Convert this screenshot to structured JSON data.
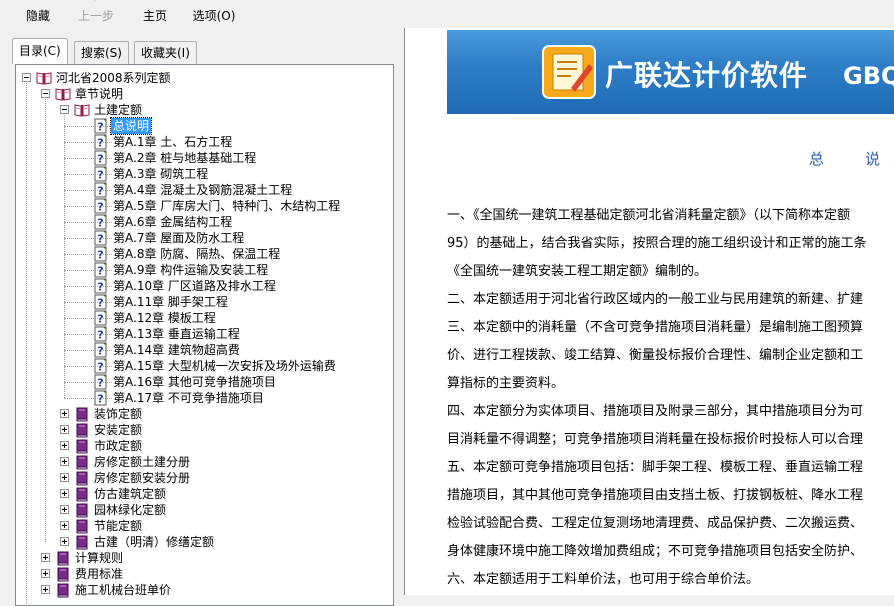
{
  "toolbar": {
    "hide": "隐藏",
    "back": "上一步",
    "home": "主页",
    "options": "选项(O)"
  },
  "tabs": [
    "目录(C)",
    "搜索(S)",
    "收藏夹(I)"
  ],
  "tree": {
    "root": "河北省2008系列定额",
    "chapter_notes": "章节说明",
    "civil": "土建定额",
    "topics": [
      "总说明",
      "第A.1章  土、石方工程",
      "第A.2章  桩与地基基础工程",
      "第A.3章  砌筑工程",
      "第A.4章  混凝土及钢筋混凝土工程",
      "第A.5章  厂库房大门、特种门、木结构工程",
      "第A.6章  金属结构工程",
      "第A.7章  屋面及防水工程",
      "第A.8章  防腐、隔热、保温工程",
      "第A.9章  构件运输及安装工程",
      "第A.10章  厂区道路及排水工程",
      "第A.11章  脚手架工程",
      "第A.12章  模板工程",
      "第A.13章  垂直运输工程",
      "第A.14章  建筑物超高费",
      "第A.15章  大型机械一次安拆及场外运输费",
      "第A.16章  其他可竞争措施项目",
      "第A.17章  不可竞争措施项目"
    ],
    "books": [
      "装饰定额",
      "安装定额",
      "市政定额",
      "房修定额土建分册",
      "房修定额安装分册",
      "仿古建筑定额",
      "园林绿化定额",
      "节能定额",
      "古建（明清）修缮定额"
    ],
    "top_books": [
      "计算规则",
      "费用标准",
      "施工机械台班单价"
    ]
  },
  "content": {
    "banner_title": "广联达计价软件",
    "banner_brand": "GBQ",
    "heading_chars": [
      "总",
      "说"
    ],
    "paragraphs": [
      "一、《全国统一建筑工程基础定额河北省消耗量定额》（以下简称本定额",
      "95）的基础上，结合我省实际，按照合理的施工组织设计和正常的施工条",
      "《全国统一建筑安装工程工期定额》编制的。",
      "二、本定额适用于河北省行政区域内的一般工业与民用建筑的新建、扩建",
      "三、本定额中的消耗量（不含可竞争措施项目消耗量）是编制施工图预算",
      "价、进行工程拨款、竣工结算、衡量投标报价合理性、编制企业定额和工",
      "算指标的主要资料。",
      "四、本定额分为实体项目、措施项目及附录三部分，其中措施项目分为可",
      "目消耗量不得调整；可竞争措施项目消耗量在投标报价时投标人可以合理",
      "五、本定额可竞争措施项目包括：脚手架工程、模板工程、垂直运输工程",
      "措施项目，其中其他可竞争措施项目由支挡土板、打拔钢板桩、降水工程",
      "检验试验配合费、工程定位复测场地清理费、成品保护费、二次搬运费、",
      "身体健康环境中施工降效增加费组成；不可竞争措施项目包括安全防护、",
      "六、本定额适用于工料单价法，也可用于综合单价法。"
    ]
  },
  "colors": {
    "selection": "#3399ff",
    "banner": "#2f7fc8",
    "heading": "#2a5fa8",
    "book_closed": "#7a2a8a"
  }
}
